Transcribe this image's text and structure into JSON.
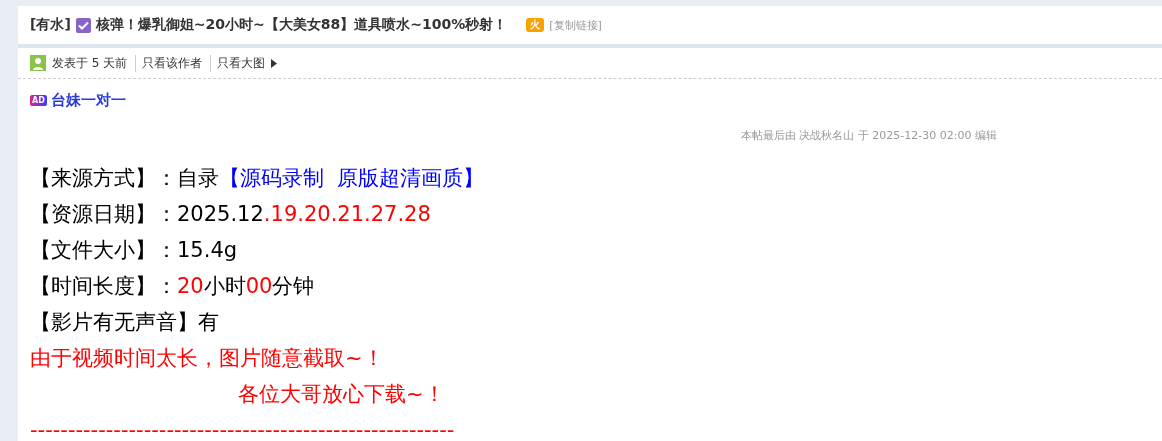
{
  "thread": {
    "tag": "[有水]",
    "title": "核弹！爆乳御姐~20小时~【大美女88】道具喷水~100%秒射！",
    "hot_badge": "火",
    "copy_link": "[复制链接]"
  },
  "meta": {
    "posted": "发表于 5 天前",
    "links": [
      "只看该作者",
      "只看大图"
    ]
  },
  "ad": {
    "badge": "AD",
    "label": "台妹一对一"
  },
  "edit_note": "本帖最后由 决战秋名山 于 2025-12-30 02:00 编辑",
  "lines": [
    {
      "indent": false,
      "segments": [
        {
          "text": "【来源方式】：",
          "color": "#000000"
        },
        {
          "text": "自录",
          "color": "#000000"
        },
        {
          "text": "【源码录制  原版超清画质】",
          "color": "#0000ff"
        }
      ]
    },
    {
      "indent": false,
      "segments": [
        {
          "text": "【资源日期】：",
          "color": "#000000"
        },
        {
          "text": "2025.12",
          "color": "#000000"
        },
        {
          "text": ".19.20.21.27.28",
          "color": "#ff0000"
        }
      ]
    },
    {
      "indent": false,
      "segments": [
        {
          "text": "【文件大小】：",
          "color": "#000000"
        },
        {
          "text": "15.4g",
          "color": "#000000"
        }
      ]
    },
    {
      "indent": false,
      "segments": [
        {
          "text": "【时间长度】：",
          "color": "#000000"
        },
        {
          "text": "20",
          "color": "#ff0000"
        },
        {
          "text": "小时",
          "color": "#000000"
        },
        {
          "text": "00",
          "color": "#ff0000"
        },
        {
          "text": "分钟",
          "color": "#000000"
        }
      ]
    },
    {
      "indent": false,
      "segments": [
        {
          "text": "【影片有无声音】有",
          "color": "#000000"
        }
      ]
    },
    {
      "indent": false,
      "segments": [
        {
          "text": "由于视频时间太长，图片随意截取~！",
          "color": "#ff0000"
        }
      ]
    },
    {
      "indent": true,
      "segments": [
        {
          "text": "各位大哥放心下载~！",
          "color": "#ff0000"
        }
      ]
    },
    {
      "indent": false,
      "segments": [
        {
          "text": "--------------------------------------------------------",
          "color": "#ff0000"
        }
      ]
    }
  ]
}
